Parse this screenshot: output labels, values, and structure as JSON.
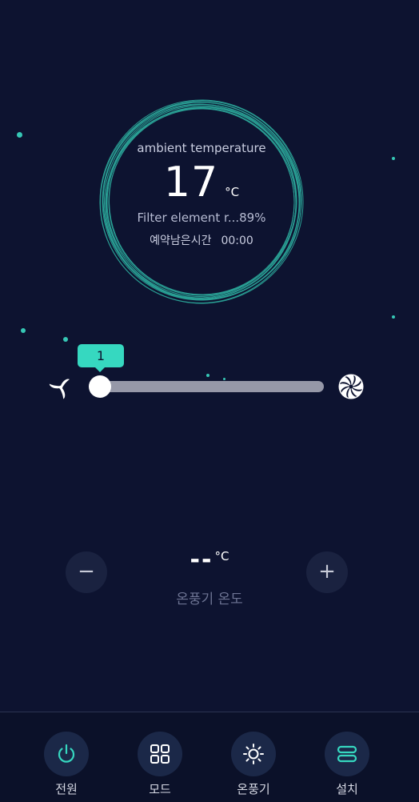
{
  "ambient": {
    "label": "ambient temperature",
    "value": "17",
    "unit": "°C"
  },
  "filter": {
    "text": "Filter element r...89%"
  },
  "reservation": {
    "label": "예약남은시간",
    "time": "00:00"
  },
  "fan_speed": {
    "value": "1",
    "level_fraction": 0.0
  },
  "heater": {
    "temp_value": "--",
    "temp_unit": "°C",
    "label": "온풍기 온도",
    "minus_label": "−",
    "plus_label": "+"
  },
  "nav": {
    "items": [
      {
        "label": "전원",
        "icon": "power-icon",
        "color": "#36d8c0"
      },
      {
        "label": "모드",
        "icon": "grid-icon",
        "color": "#ffffff"
      },
      {
        "label": "온풍기",
        "icon": "sun-icon",
        "color": "#ffffff"
      },
      {
        "label": "설치",
        "icon": "settings-bars-icon",
        "color": "#36d8c0"
      }
    ]
  },
  "colors": {
    "background": "#0d1330",
    "accent": "#36d8c0",
    "track": "#9698a8"
  }
}
